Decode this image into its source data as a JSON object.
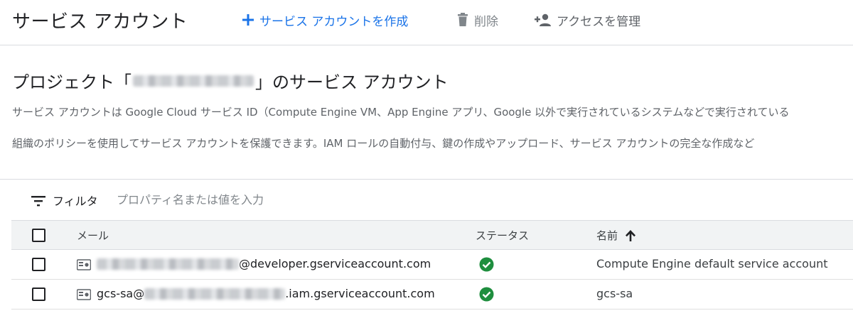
{
  "toolbar": {
    "title": "サービス アカウント",
    "create_label": "サービス アカウントを作成",
    "delete_label": "削除",
    "manage_label": "アクセスを管理"
  },
  "section": {
    "title_prefix": "プロジェクト「",
    "title_suffix": "」のサービス アカウント",
    "desc1": "サービス アカウントは Google Cloud サービス ID（Compute Engine VM、App Engine アプリ、Google 以外で実行されているシステムなどで実行されている",
    "desc2": "組織のポリシーを使用してサービス アカウントを保護できます。IAM ロールの自動付与、鍵の作成やアップロード、サービス アカウントの完全な作成など"
  },
  "filter": {
    "label": "フィルタ",
    "placeholder": "プロパティ名または値を入力",
    "value": ""
  },
  "table": {
    "headers": {
      "email": "メール",
      "status": "ステータス",
      "name": "名前"
    },
    "rows": [
      {
        "email_prefix": "",
        "email_suffix": "@developer.gserviceaccount.com",
        "status": "enabled",
        "name": "Compute Engine default service account"
      },
      {
        "email_prefix": "gcs-sa@",
        "email_suffix": ".iam.gserviceaccount.com",
        "status": "enabled",
        "name": "gcs-sa"
      }
    ]
  },
  "icons": {
    "add": "plus-icon",
    "delete": "trash-icon",
    "manage": "person-add-icon",
    "filter": "filter-list-icon",
    "sort": "arrow-up-icon",
    "service_account": "service-account-key-icon",
    "status_ok": "check-circle-icon"
  },
  "colors": {
    "accent": "#1a73e8",
    "success": "#1e8e3e",
    "muted": "#5f6368",
    "header_bg": "#f1f3f4"
  }
}
